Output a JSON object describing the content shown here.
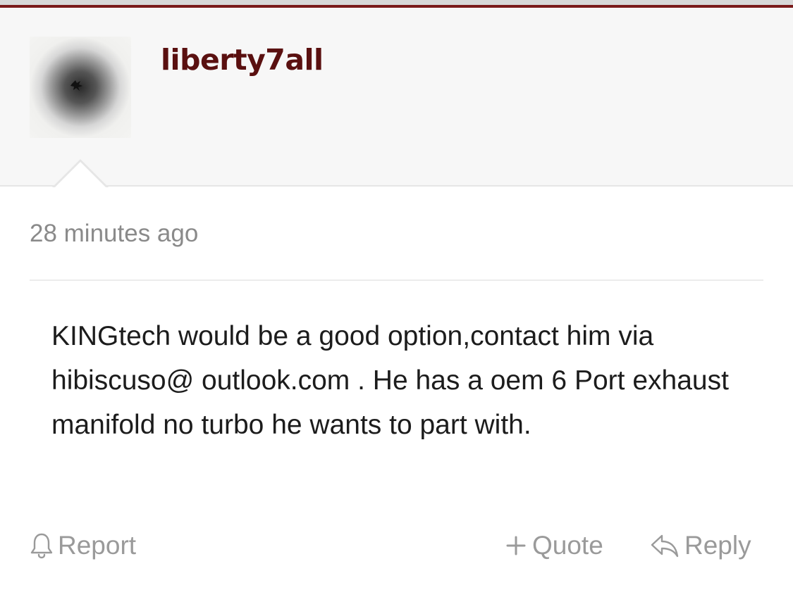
{
  "post": {
    "author": "liberty7all",
    "timestamp": "28 minutes ago",
    "body": "KINGtech would be a good option,contact him via hibiscuso@ outlook.com . He has a oem 6 Port exhaust manifold no turbo he wants to part with."
  },
  "actions": {
    "report_label": "Report",
    "quote_label": "Quote",
    "reply_label": "Reply"
  },
  "icons": {
    "report": "bell-icon",
    "quote": "plus-icon",
    "reply": "reply-arrow-icon"
  },
  "colors": {
    "accent": "#7a1a1a",
    "username": "#5a1010",
    "muted_text": "#9a9a9a",
    "body_text": "#1c1c1c",
    "header_bg": "#f7f7f7"
  }
}
